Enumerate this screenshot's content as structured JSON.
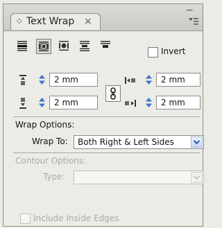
{
  "panel": {
    "tab_title": "Text Wrap",
    "tab_arrow": "◇",
    "close_glyph": "×",
    "minimize_glyph": "−"
  },
  "wrap_modes": [
    {
      "name": "no-text-wrap",
      "active": false
    },
    {
      "name": "wrap-around-bounding-box",
      "active": true
    },
    {
      "name": "wrap-around-object-shape",
      "active": false
    },
    {
      "name": "jump-object",
      "active": false
    },
    {
      "name": "jump-to-next-column",
      "active": false
    }
  ],
  "invert": {
    "label": "Invert",
    "checked": false
  },
  "offsets": {
    "top": "2 mm",
    "bottom": "2 mm",
    "left": "2 mm",
    "right": "2 mm",
    "linked": true
  },
  "wrap_options": {
    "heading": "Wrap Options:",
    "wrap_to_label": "Wrap To:",
    "wrap_to_value": "Both Right & Left Sides"
  },
  "contour_options": {
    "heading": "Contour Options:",
    "type_label": "Type:",
    "type_value": "",
    "enabled": false
  },
  "include_inside_edges": {
    "label": "Include Inside Edges",
    "checked": false,
    "enabled": false
  },
  "colors": {
    "spinner_arrow": "#3e73c9",
    "dropdown_arrow": "#2b5fb5",
    "disabled_text": "#a9a9a6"
  }
}
